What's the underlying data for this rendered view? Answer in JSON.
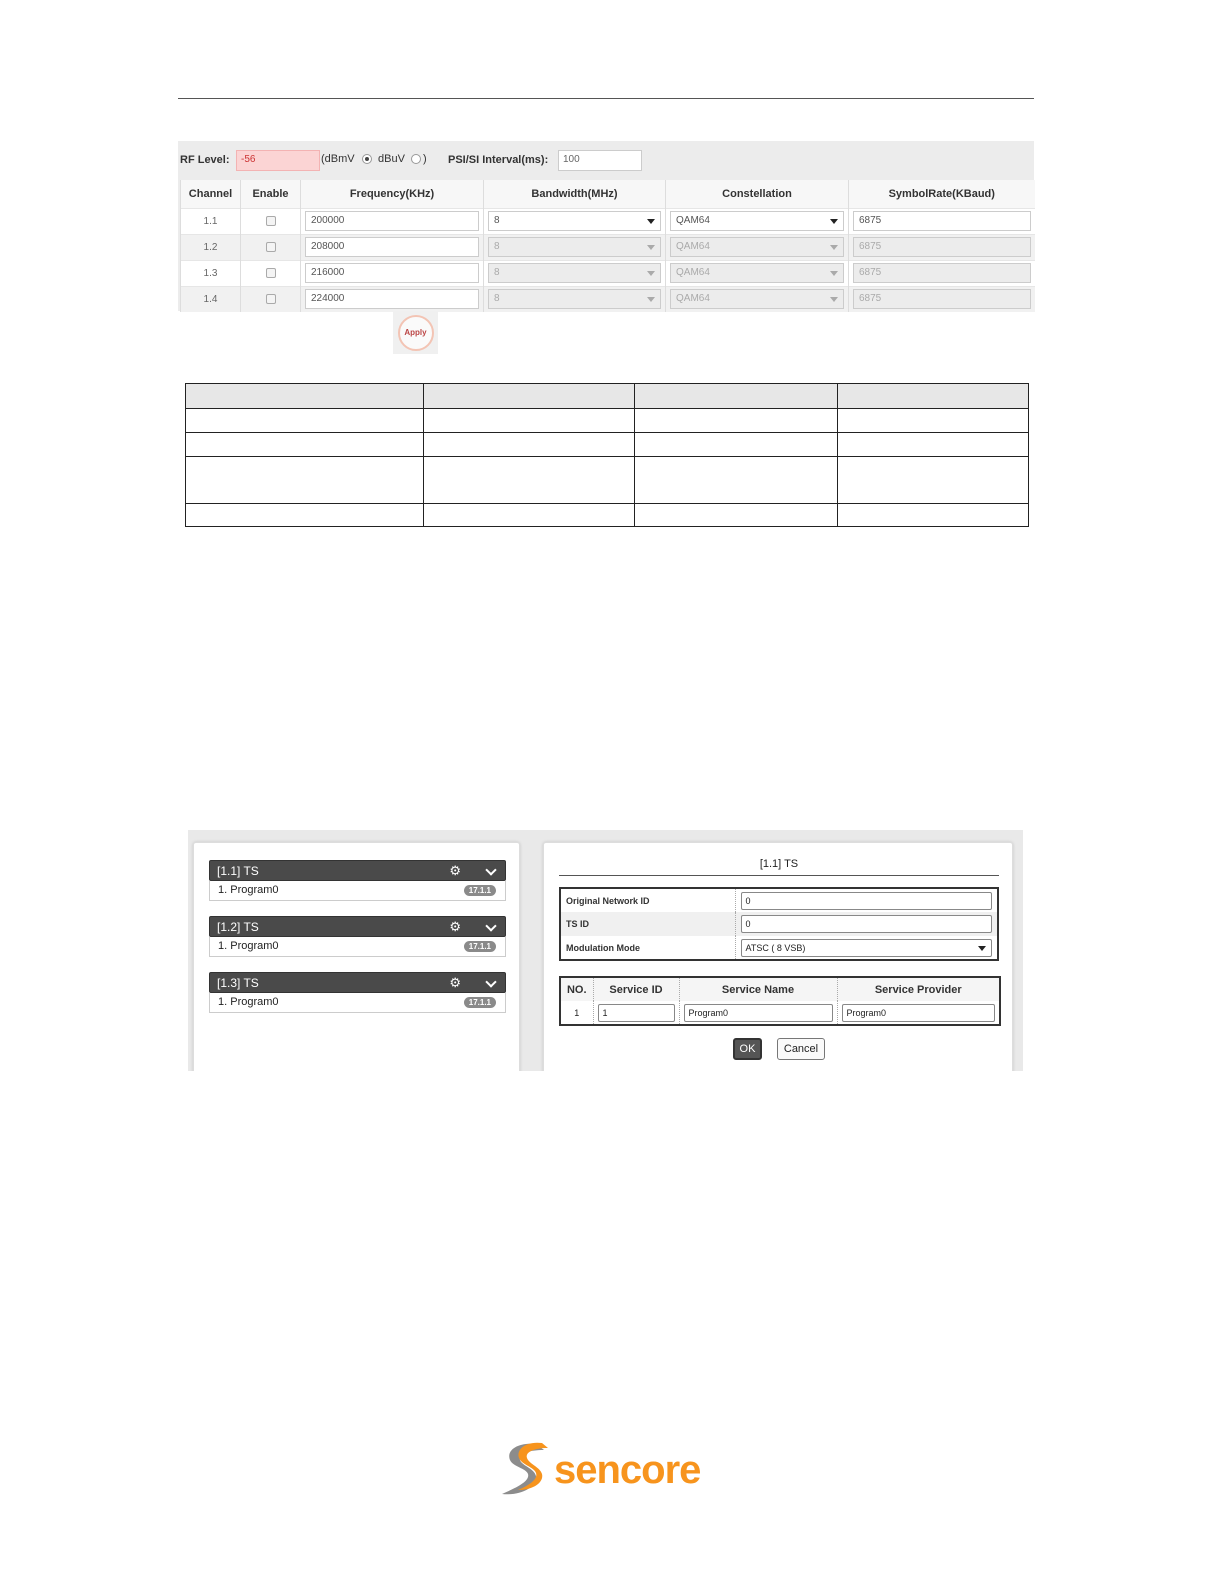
{
  "rf_panel": {
    "rf_level_label": "RF Level:",
    "rf_level_value": "-56",
    "unit_open": "(dBmV",
    "unit_dbmv_selected": true,
    "unit_dbuv": "dBuV",
    "unit_close": ")",
    "psi_label": "PSI/SI Interval(ms):",
    "psi_value": "100",
    "columns": [
      "Channel",
      "Enable",
      "Frequency(KHz)",
      "Bandwidth(MHz)",
      "Constellation",
      "SymbolRate(KBaud)"
    ],
    "rows": [
      {
        "channel": "1.1",
        "frequency": "200000",
        "bandwidth": "8",
        "constellation": "QAM64",
        "symbol_rate": "6875"
      },
      {
        "channel": "1.2",
        "frequency": "208000",
        "bandwidth": "8",
        "constellation": "QAM64",
        "symbol_rate": "6875"
      },
      {
        "channel": "1.3",
        "frequency": "216000",
        "bandwidth": "8",
        "constellation": "QAM64",
        "symbol_rate": "6875"
      },
      {
        "channel": "1.4",
        "frequency": "224000",
        "bandwidth": "8",
        "constellation": "QAM64",
        "symbol_rate": "6875"
      }
    ],
    "apply_label": "Apply"
  },
  "ts_list": [
    {
      "title": "[1.1] TS",
      "program": "1. Program0",
      "badge": "17.1.1"
    },
    {
      "title": "[1.2] TS",
      "program": "1. Program0",
      "badge": "17.1.1"
    },
    {
      "title": "[1.3] TS",
      "program": "1. Program0",
      "badge": "17.1.1"
    }
  ],
  "ts_detail": {
    "title": "[1.1] TS",
    "original_network_id_label": "Original Network ID",
    "original_network_id": "0",
    "ts_id_label": "TS ID",
    "ts_id": "0",
    "modulation_label": "Modulation Mode",
    "modulation": "ATSC ( 8 VSB)",
    "service_columns": [
      "NO.",
      "Service ID",
      "Service Name",
      "Service Provider"
    ],
    "services": [
      {
        "no": "1",
        "service_id": "1",
        "service_name": "Program0",
        "service_provider": "Program0"
      }
    ],
    "ok_label": "OK",
    "cancel_label": "Cancel"
  },
  "logo": {
    "text": "sencore",
    "brand_color": "#f7941d",
    "mark_color": "#8c8c8c"
  }
}
